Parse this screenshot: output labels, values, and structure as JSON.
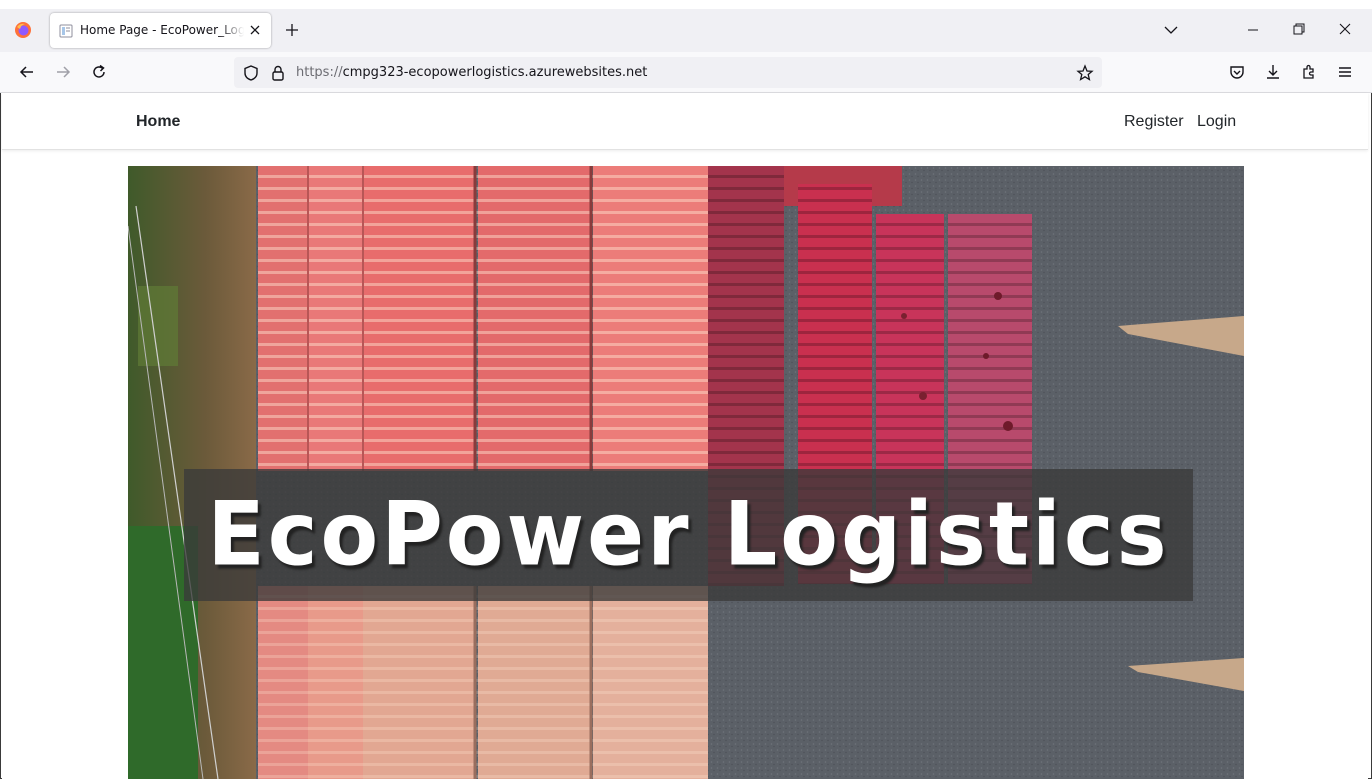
{
  "browser": {
    "tab": {
      "title": "Home Page - EcoPower_Logistics"
    },
    "url": {
      "scheme": "https://",
      "host": "cmpg323-ecopowerlogistics.azurewebsites.net"
    }
  },
  "site": {
    "nav": {
      "brand": "Home",
      "register": "Register",
      "login": "Login"
    },
    "hero": {
      "title": "EcoPower Logistics"
    }
  },
  "colors": {
    "container_red": "#e86f72",
    "container_crimson": "#c9304f",
    "ground": "#5a5f66",
    "title_band": "#3a3a3a"
  }
}
